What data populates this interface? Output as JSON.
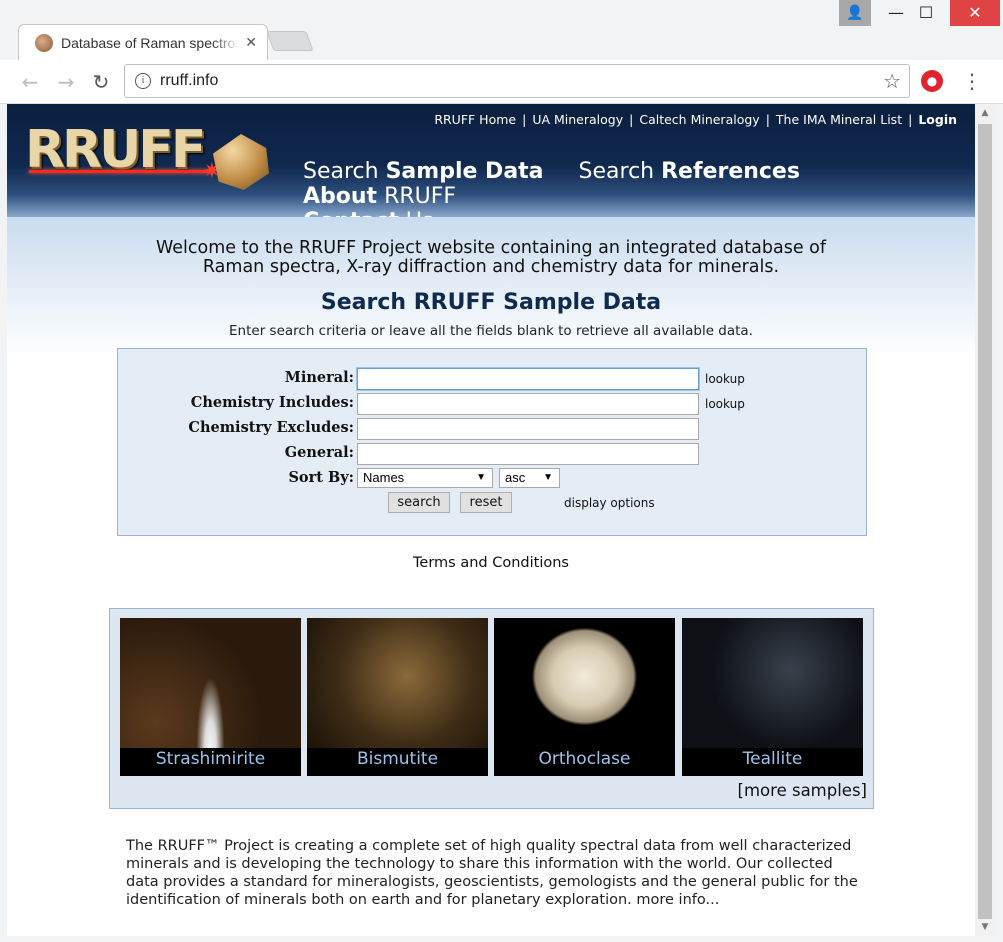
{
  "browser": {
    "tab_title": "Database of Raman spectroscopy",
    "url": "rruff.info",
    "tab_close_glyph": "✕",
    "window_controls": {
      "minimize": "—",
      "maximize": "☐",
      "close": "✕"
    }
  },
  "header": {
    "logo_text": "RRUFF",
    "top_links": [
      "RRUFF Home",
      "UA Mineralogy",
      "Caltech Mineralogy",
      "The IMA Mineral List"
    ],
    "login": "Login",
    "nav": [
      {
        "prefix": "Search ",
        "bold": "Sample Data",
        "suffix": ""
      },
      {
        "prefix": "Search ",
        "bold": "References",
        "suffix": ""
      },
      {
        "prefix": "",
        "bold": "About",
        "suffix": " RRUFF"
      },
      {
        "prefix": "",
        "bold": "Contact",
        "suffix": " Us"
      }
    ]
  },
  "welcome": {
    "line1": "Welcome to the RRUFF Project website containing an integrated database of",
    "line2": "Raman spectra, X-ray diffraction and chemistry data for minerals."
  },
  "search": {
    "title": "Search RRUFF Sample Data",
    "subtitle": "Enter search criteria or leave all the fields blank to retrieve all available data.",
    "fields": {
      "mineral": {
        "label": "Mineral:",
        "value": "",
        "lookup": "lookup"
      },
      "chem_includes": {
        "label": "Chemistry Includes:",
        "value": "",
        "lookup": "lookup"
      },
      "chem_excludes": {
        "label": "Chemistry Excludes:",
        "value": ""
      },
      "general": {
        "label": "General:",
        "value": ""
      }
    },
    "sort": {
      "label": "Sort By:",
      "field": "Names",
      "order": "asc"
    },
    "buttons": {
      "search": "search",
      "reset": "reset"
    },
    "display_options": "display options"
  },
  "terms": "Terms and Conditions",
  "samples": {
    "items": [
      "Strashimirite",
      "Bismutite",
      "Orthoclase",
      "Teallite"
    ],
    "more": "[more samples]"
  },
  "about": {
    "text": "The RRUFF™ Project is creating a complete set of high quality spectral data from well characterized minerals and is developing the technology to share this information with the world. Our collected data provides a standard for mineralogists, geoscientists, gemologists and the general public for the identification of minerals both on earth and for planetary exploration.",
    "more": " more info..."
  }
}
